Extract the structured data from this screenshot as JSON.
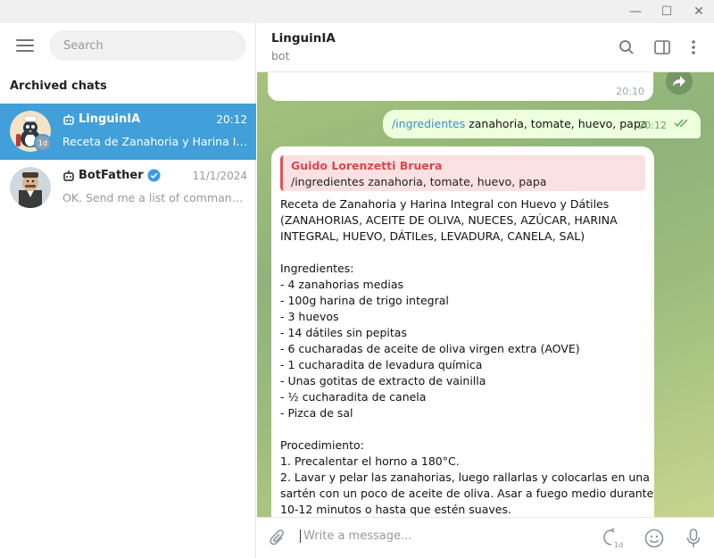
{
  "window": {
    "minimize_glyph": "—",
    "maximize_glyph": "☐",
    "close_glyph": "✕"
  },
  "sidebar": {
    "search_placeholder": "Search",
    "section_title": "Archived chats",
    "chats": [
      {
        "name": "LinguinIA",
        "time": "20:12",
        "preview": "Receta de Zanahoria y Harina Integral con Huevo y Dátiles",
        "badge": "1d",
        "is_bot": true,
        "active": true
      },
      {
        "name": "BotFather",
        "time": "11/1/2024",
        "preview": "OK. Send me a list of commands for your bot",
        "is_bot": true,
        "verified": true,
        "active": false
      }
    ]
  },
  "chat": {
    "title": "LinguinIA",
    "subtitle": "bot",
    "prev_message_time": "20:10",
    "outgoing": {
      "command": "/ingredientes",
      "text": " zanahoria, tomate, huevo, papa",
      "time": "20:12"
    },
    "incoming": {
      "reply_author": "Guido Lorenzetti Bruera",
      "reply_text": "/ingredientes zanahoria, tomate, huevo, papa",
      "lines": [
        "Receta de Zanahoria y Harina Integral con Huevo y Dátiles",
        "(ZANAHORIAS, ACEITE DE OLIVA, NUECES, AZÚCAR, HARINA",
        "INTEGRAL, HUEVO, DÁTILes, LEVADURA, CANELA, SAL)",
        "",
        "Ingredientes:",
        "- 4 zanahorias medias",
        "- 100g harina de trigo integral",
        "- 3 huevos",
        "- 14 dátiles sin pepitas",
        "- 6 cucharadas de aceite de oliva virgen extra (AOVE)",
        "- 1 cucharadita de levadura química",
        "- Unas gotitas de extracto de vainilla",
        "- ½ cucharadita de canela",
        "- Pizca de sal",
        "",
        "Procedimiento:",
        "1. Precalentar el horno a 180°C.",
        "2. Lavar y pelar las zanahorias, luego rallarlas y colocarlas en una",
        "sartén con un poco de aceite de oliva. Asar a fuego medio durante",
        "10-12 minutos o hasta que estén suaves."
      ]
    },
    "composer_placeholder": "Write a message...",
    "timer_badge": "1d"
  },
  "colors": {
    "accent": "#419fd9",
    "outgoing_bubble": "#eeffde",
    "reply_author": "#d9484e",
    "command_link": "#3a8fc9"
  }
}
